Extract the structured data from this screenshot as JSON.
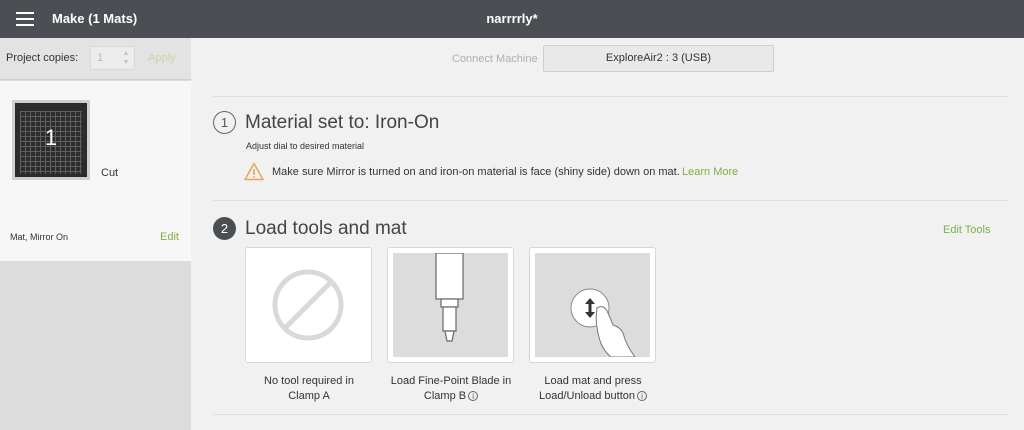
{
  "header": {
    "menu_icon": "hamburger-menu-icon",
    "title": "Make (1 Mats)",
    "document_title": "narrrrly*"
  },
  "sidebar": {
    "copies_label": "Project copies:",
    "copies_value": "1",
    "apply_label": "Apply",
    "mat": {
      "number": "1",
      "operation": "Cut",
      "note": "Mat, Mirror On",
      "edit_label": "Edit"
    }
  },
  "machine": {
    "connect_label": "Connect Machine",
    "device": "ExploreAir2 : 3 (USB)"
  },
  "step1": {
    "number": "1",
    "title": "Material set to: Iron-On",
    "instruction": "Adjust dial to desired material",
    "warning": "Make sure Mirror is turned on and iron-on material is face (shiny side) down on mat.",
    "learn_more": "Learn More",
    "warning_icon": "warning-triangle-icon"
  },
  "step2": {
    "number": "2",
    "title": "Load tools and mat",
    "edit_tools": "Edit Tools",
    "tools": [
      {
        "line1": "No tool required in",
        "line2": "Clamp A",
        "icon": "no-tool-icon"
      },
      {
        "line1": "Load Fine-Point Blade in",
        "line2": "Clamp B",
        "icon": "blade-icon",
        "info_icon": "info-icon"
      },
      {
        "line1": "Load mat and press",
        "line2": "Load/Unload button",
        "icon": "load-unload-button-icon",
        "info_icon": "info-icon"
      }
    ]
  },
  "colors": {
    "topbar": "#4b4e52",
    "accent_green": "#7cb342",
    "background": "#f1f1f1"
  }
}
